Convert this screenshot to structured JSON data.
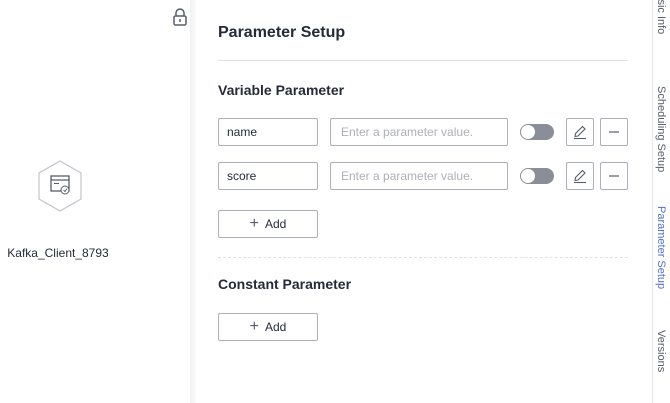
{
  "canvas": {
    "node_label": "Kafka_Client_8793"
  },
  "panel": {
    "title": "Parameter Setup",
    "variable_section": {
      "title": "Variable Parameter",
      "rows": [
        {
          "name": "name",
          "value_placeholder": "Enter a parameter value."
        },
        {
          "name": "score",
          "value_placeholder": "Enter a parameter value."
        }
      ],
      "add_label": "Add"
    },
    "constant_section": {
      "title": "Constant Parameter",
      "add_label": "Add"
    }
  },
  "right_tabs": [
    {
      "label": "Basic Info"
    },
    {
      "label": "Scheduling Setup"
    },
    {
      "label": "Parameter Setup",
      "active": true
    },
    {
      "label": "Versions"
    }
  ],
  "colors": {
    "accent": "#526ecc",
    "border": "#adb0b8",
    "toggle_off": "#8a8e99",
    "text": "#252b3a"
  },
  "icons": [
    "lock-icon",
    "kafka-client-node-icon",
    "edit-icon",
    "remove-icon",
    "plus-icon"
  ]
}
